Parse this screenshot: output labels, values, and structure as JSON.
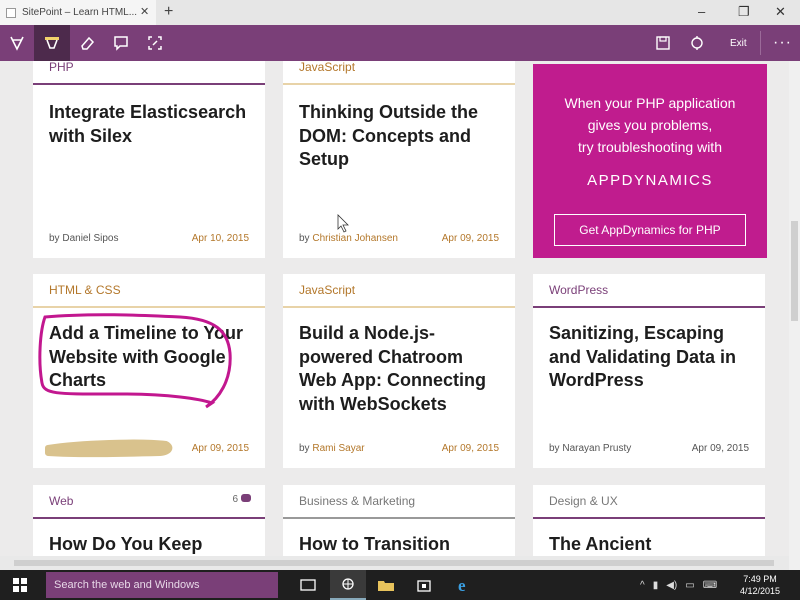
{
  "browser": {
    "tab_title": "SitePoint – Learn HTML...",
    "new_tab": "+",
    "window_controls": {
      "minimize": "–",
      "maximize": "❐",
      "close": "✕"
    }
  },
  "inkbar": {
    "tools": [
      "pen-icon",
      "highlighter-icon",
      "eraser-icon",
      "note-icon",
      "clip-icon"
    ],
    "exit_label": "Exit",
    "more_label": "···"
  },
  "cards": [
    {
      "category": "PHP",
      "title": "Integrate Elasticsearch with Silex",
      "by": "by",
      "author": "Daniel Sipos",
      "date": "Apr 10, 2015"
    },
    {
      "category": "JavaScript",
      "title": "Thinking Outside the DOM: Concepts and Setup",
      "by": "by",
      "author": "Christian Johansen",
      "date": "Apr 09, 2015"
    },
    {
      "category": "HTML & CSS",
      "title": "Add a Timeline to Your Website with Google Charts",
      "date": "Apr 09, 2015"
    },
    {
      "category": "JavaScript",
      "title": "Build a Node.js-powered Chatroom Web App: Connecting with WebSockets",
      "by": "by",
      "author": "Rami Sayar",
      "date": "Apr 09, 2015"
    },
    {
      "category": "WordPress",
      "title": "Sanitizing, Escaping and Validating Data in WordPress",
      "by": "by",
      "author": "Narayan Prusty",
      "date": "Apr 09, 2015"
    },
    {
      "category": "Web",
      "title": "How Do You Keep",
      "comments": "6"
    },
    {
      "category": "Business & Marketing",
      "title": "How to Transition"
    },
    {
      "category": "Design & UX",
      "title": "The Ancient"
    }
  ],
  "ad": {
    "copy_line1": "When your PHP application",
    "copy_line2": "gives you problems,",
    "copy_line3": "try troubleshooting with",
    "brand": "APPDYNAMICS",
    "cta": "Get AppDynamics for PHP",
    "color": "#c01c8e"
  },
  "taskbar": {
    "search_placeholder": "Search the web and Windows",
    "time": "7:49 PM",
    "date": "4/12/2015"
  },
  "colors": {
    "accent": "#7a3f78",
    "category_orange": "#b3772a"
  }
}
